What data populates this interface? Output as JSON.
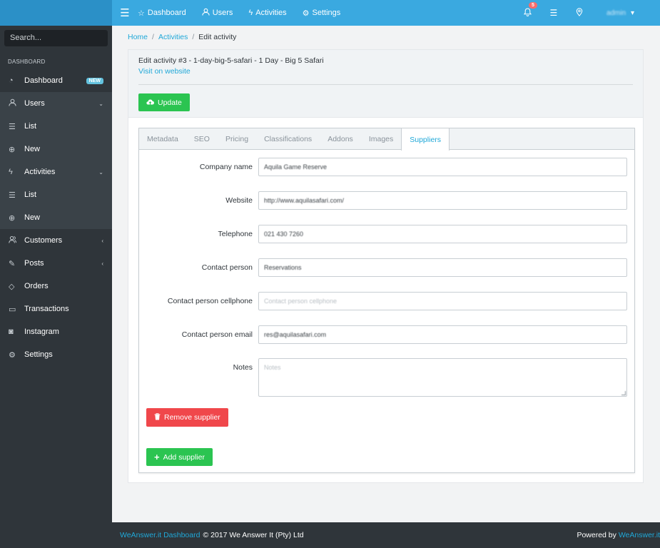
{
  "header": {
    "nav": [
      {
        "label": "Dashboard",
        "icon": "star-icon"
      },
      {
        "label": "Users",
        "icon": "user-icon"
      },
      {
        "label": "Activities",
        "icon": "lightning-icon"
      },
      {
        "label": "Settings",
        "icon": "gear-icon"
      }
    ],
    "notifications_count": "5",
    "user_label": "admin"
  },
  "sidebar": {
    "search_placeholder": "Search...",
    "section_title": "DASHBOARD",
    "items": [
      {
        "label": "Dashboard",
        "badge": "NEW"
      },
      {
        "label": "Users"
      },
      {
        "label": "List"
      },
      {
        "label": "New"
      },
      {
        "label": "Activities"
      },
      {
        "label": "List"
      },
      {
        "label": "New"
      },
      {
        "label": "Customers"
      },
      {
        "label": "Posts"
      },
      {
        "label": "Orders"
      },
      {
        "label": "Transactions"
      },
      {
        "label": "Instagram"
      },
      {
        "label": "Settings"
      }
    ]
  },
  "breadcrumb": {
    "home": "Home",
    "activities": "Activities",
    "current": "Edit activity"
  },
  "card": {
    "title": "Edit activity #3 - 1-day-big-5-safari - 1 Day - Big 5 Safari",
    "link": "Visit on website",
    "update_label": "Update"
  },
  "tabs": [
    "Metadata",
    "SEO",
    "Pricing",
    "Classifications",
    "Addons",
    "Images",
    "Suppliers"
  ],
  "active_tab": "Suppliers",
  "form": {
    "company_name": {
      "label": "Company name",
      "value": "Aquila Game Reserve"
    },
    "website": {
      "label": "Website",
      "value": "http://www.aquilasafari.com/"
    },
    "telephone": {
      "label": "Telephone",
      "value": "021 430 7260"
    },
    "contact_person": {
      "label": "Contact person",
      "value": "Reservations"
    },
    "contact_cellphone": {
      "label": "Contact person cellphone",
      "placeholder": "Contact person cellphone"
    },
    "contact_email": {
      "label": "Contact person email",
      "value": "res@aquilasafari.com"
    },
    "notes": {
      "label": "Notes",
      "placeholder": "Notes"
    }
  },
  "buttons": {
    "remove_supplier": "Remove supplier",
    "add_supplier": "Add supplier"
  },
  "footer": {
    "brand_link": "WeAnswer.it Dashboard",
    "copyright": "© 2017 We Answer It (Pty) Ltd",
    "powered_by": "Powered by",
    "powered_link": "WeAnswer.it"
  },
  "colors": {
    "header": "#3aa9e0",
    "sidebar": "#2f353a",
    "success": "#2bc451",
    "danger": "#f0474b",
    "link": "#20a8d8"
  }
}
